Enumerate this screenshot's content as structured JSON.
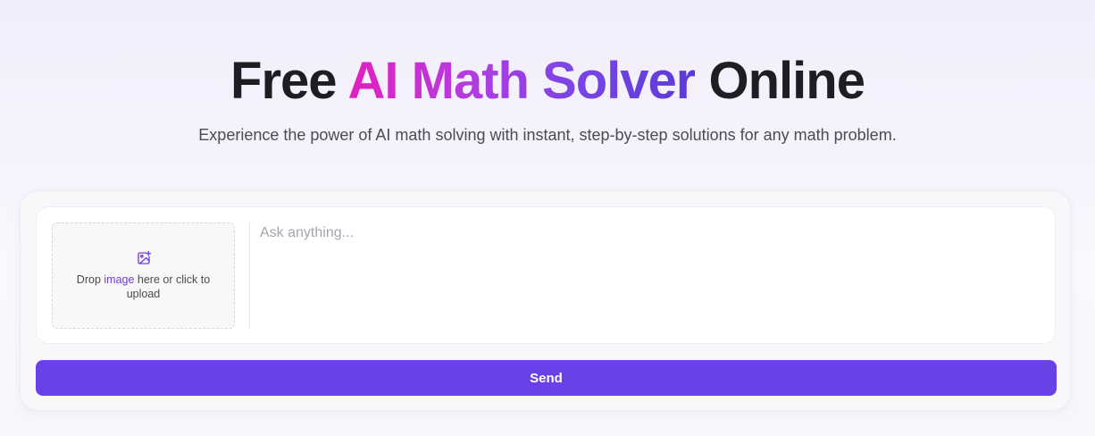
{
  "hero": {
    "title_prefix": "Free ",
    "title_highlight": "AI Math Solver",
    "title_suffix": " Online",
    "subtitle": "Experience the power of AI math solving with instant, step-by-step solutions for any math problem."
  },
  "upload": {
    "icon": "image-plus-icon",
    "text_before": "Drop ",
    "link_text": "image",
    "text_after": " here or click to upload"
  },
  "input": {
    "placeholder": "Ask anything...",
    "value": ""
  },
  "send_button": {
    "label": "Send"
  },
  "colors": {
    "accent": "#6a41e6",
    "title_gradient_start": "#e21fbf",
    "title_gradient_end": "#5b3ad8",
    "link": "#6d3fd6"
  }
}
